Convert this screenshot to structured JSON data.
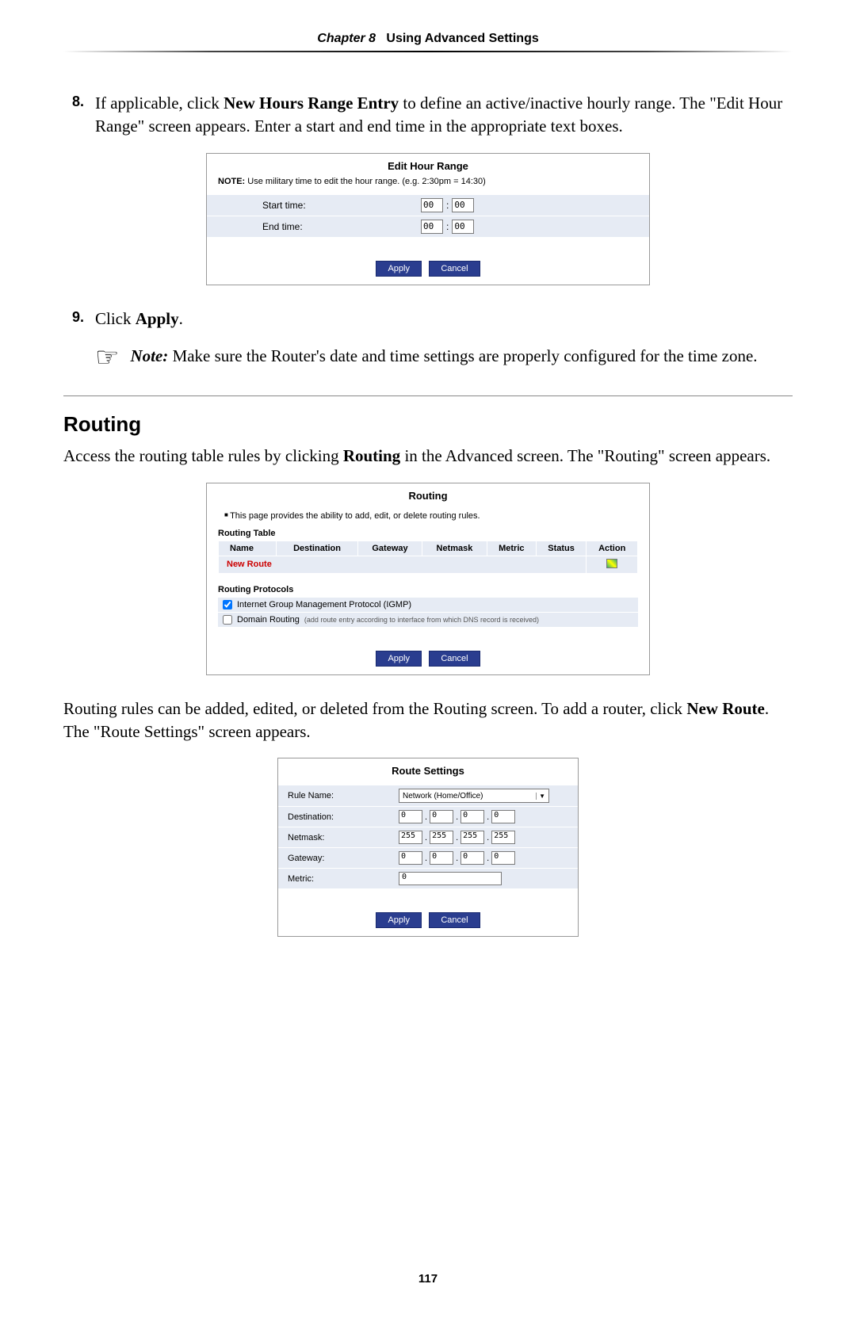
{
  "header": {
    "chapter": "Chapter 8",
    "title": "Using Advanced Settings"
  },
  "step8": {
    "num": "8.",
    "pre": "If applicable, click ",
    "bold": "New Hours Range Entry",
    "post": " to define an active/inactive hourly range. The \"Edit Hour Range\" screen appears. Enter a start and end time in the appropriate text boxes."
  },
  "editHour": {
    "title": "Edit Hour Range",
    "noteLabel": "NOTE:",
    "noteText": " Use military time to edit the hour range. (e.g. 2:30pm = 14:30)",
    "startLabel": "Start time:",
    "endLabel": "End time:",
    "h1": "00",
    "m1": "00",
    "h2": "00",
    "m2": "00",
    "apply": "Apply",
    "cancel": "Cancel"
  },
  "step9": {
    "num": "9.",
    "pre": "Click ",
    "bold": "Apply",
    "post": "."
  },
  "note": {
    "pre": "Note:",
    "text": " Make sure the Router's date and time settings are properly configured for the time zone."
  },
  "routing": {
    "heading": "Routing",
    "intro_pre": "Access the routing table rules by clicking ",
    "intro_bold": "Routing",
    "intro_post": " in the Advanced screen. The \"Routing\" screen appears.",
    "fig": {
      "title": "Routing",
      "bullet": "This page provides the ability to add, edit, or delete routing rules.",
      "tableHead": "Routing Table",
      "cols": {
        "name": "Name",
        "dest": "Destination",
        "gw": "Gateway",
        "nm": "Netmask",
        "metric": "Metric",
        "status": "Status",
        "action": "Action"
      },
      "newRoute": "New Route",
      "protoHead": "Routing Protocols",
      "igmp": "Internet Group Management Protocol (IGMP)",
      "domainRouting": "Domain Routing",
      "domainRoutingSub": "(add route entry according to interface from which DNS record is received)",
      "apply": "Apply",
      "cancel": "Cancel"
    },
    "after_pre": "Routing rules can be added, edited, or deleted from the Routing screen. To add a router, click ",
    "after_bold": "New Route",
    "after_post": ". The \"Route Settings\" screen appears."
  },
  "routeSettings": {
    "title": "Route Settings",
    "ruleName": "Rule Name:",
    "ruleValue": "Network (Home/Office)",
    "destLabel": "Destination:",
    "dest": [
      "0",
      "0",
      "0",
      "0"
    ],
    "nmLabel": "Netmask:",
    "nm": [
      "255",
      "255",
      "255",
      "255"
    ],
    "gwLabel": "Gateway:",
    "gw": [
      "0",
      "0",
      "0",
      "0"
    ],
    "metricLabel": "Metric:",
    "metric": "0",
    "apply": "Apply",
    "cancel": "Cancel"
  },
  "pageNumber": "117"
}
